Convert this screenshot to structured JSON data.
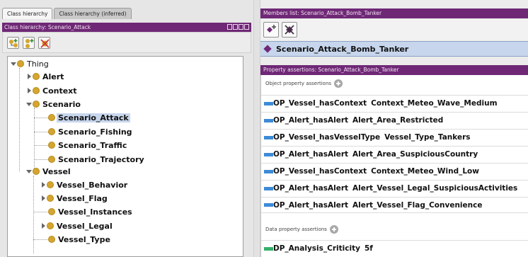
{
  "left_panel": {
    "tabs": [
      {
        "label": "Class hierarchy",
        "active": true
      },
      {
        "label": "Class hierarchy (inferred)",
        "active": false
      }
    ],
    "header": "Class hierarchy: Scenario_Attack",
    "tree": {
      "root": "Thing",
      "level1": [
        "Alert",
        "Context",
        "Scenario",
        "Vessel"
      ],
      "scenario_children": [
        "Scenario_Attack",
        "Scenario_Fishing",
        "Scenario_Traffic",
        "Scenario_Trajectory"
      ],
      "vessel_children": [
        "Vessel_Behavior",
        "Vessel_Flag",
        "Vessel_Instances",
        "Vessel_Legal",
        "Vessel_Type"
      ],
      "selected": "Scenario_Attack"
    }
  },
  "right_panel": {
    "members_header": "Members list: Scenario_Attack_Bomb_Tanker",
    "member": "Scenario_Attack_Bomb_Tanker",
    "assertions_header": "Property assertions: Scenario_Attack_Bomb_Tanker",
    "object_section": "Object property assertions",
    "object_assertions": [
      {
        "prop": "OP_Vessel_hasContext",
        "value": "Context_Meteo_Wave_Medium"
      },
      {
        "prop": "OP_Alert_hasAlert",
        "value": "Alert_Area_Restricted"
      },
      {
        "prop": "OP_Vessel_hasVesselType",
        "value": "Vessel_Type_Tankers"
      },
      {
        "prop": "OP_Alert_hasAlert",
        "value": "Alert_Area_SuspiciousCountry"
      },
      {
        "prop": "OP_Vessel_hasContext",
        "value": "Context_Meteo_Wind_Low"
      },
      {
        "prop": "OP_Alert_hasAlert",
        "value": "Alert_Vessel_Legal_SuspiciousActivities"
      },
      {
        "prop": "OP_Alert_hasAlert",
        "value": "Alert_Vessel_Flag_Convenience"
      }
    ],
    "data_section": "Data property assertions",
    "data_assertions": [
      {
        "prop": "DP_Analysis_Criticity",
        "value": "5f"
      }
    ]
  },
  "colors": {
    "header": "#6f2876",
    "selection": "#c7d6ec",
    "class_dot": "#d4a62f",
    "object_prop": "#3d8bd6",
    "data_prop": "#38b06a"
  }
}
